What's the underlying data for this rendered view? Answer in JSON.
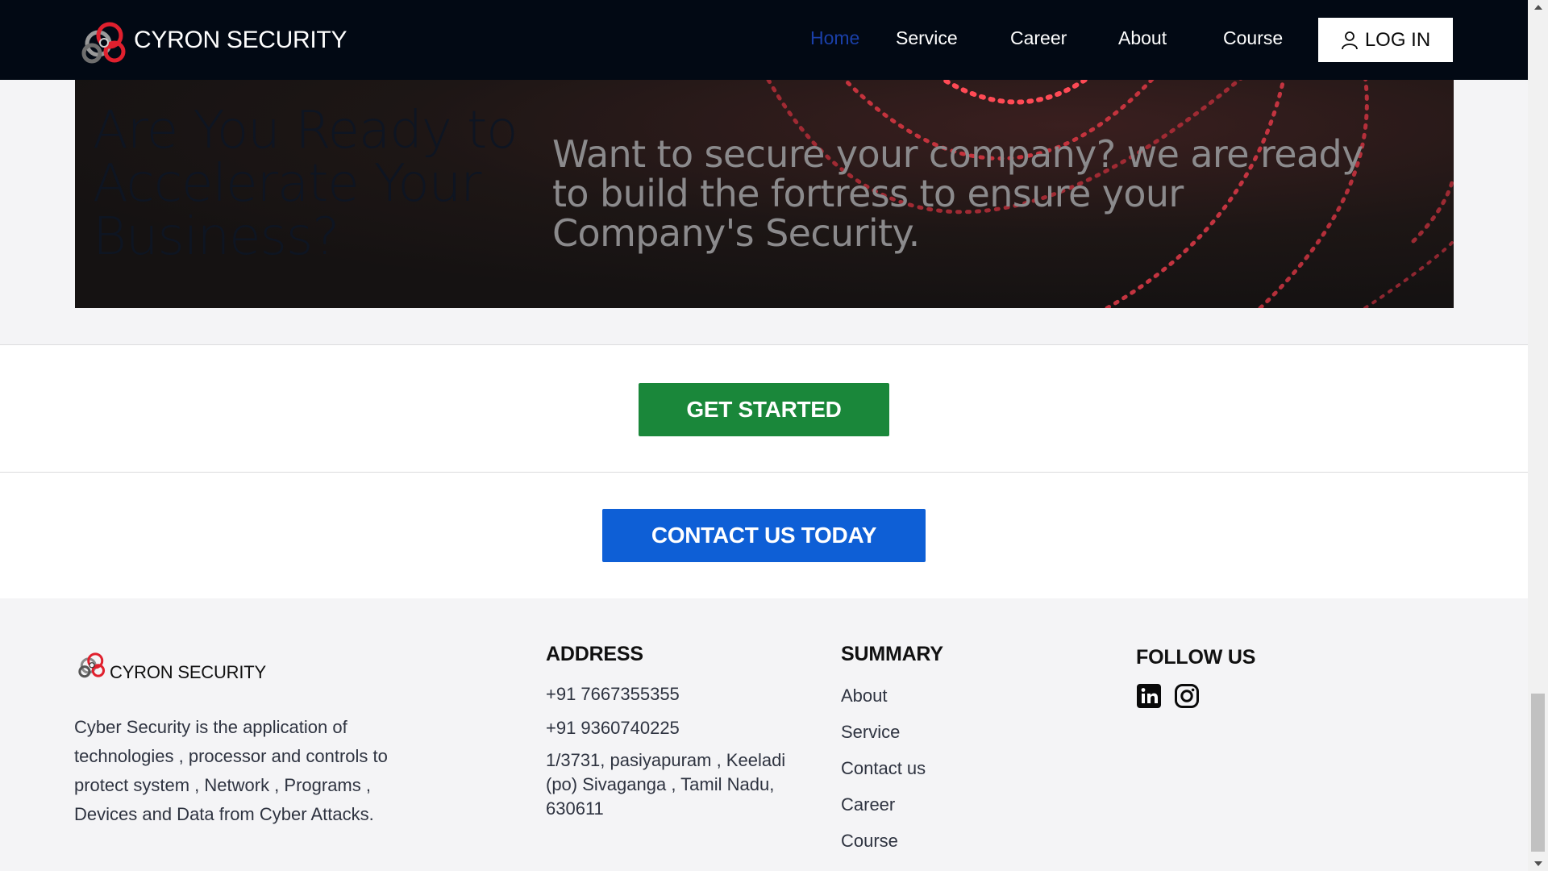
{
  "nav": {
    "brand": "CYRON SECURITY",
    "items": [
      "Home",
      "Service",
      "Career",
      "About",
      "Course"
    ],
    "active_item": "Home",
    "login_label": "LOG IN"
  },
  "hero": {
    "title": "Are You Ready to Accelerate Your Business?",
    "subtitle": "Want to secure your company? we are ready to build the fortress to ensure your Company's Security."
  },
  "cta": {
    "get_started": "GET STARTED",
    "contact": "CONTACT US TODAY"
  },
  "footer": {
    "brand": "CYRON SECURITY",
    "description": "Cyber Security is the application of technologies , processor and controls to protect system , Network , Programs , Devices and Data from Cyber Attacks.",
    "address": {
      "heading": "ADDRESS",
      "phone1": "+91 7667355355",
      "phone2": "+91 9360740225",
      "location": "1/3731, pasiyapuram , Keeladi (po) Sivaganga , Tamil Nadu, 630611"
    },
    "summary": {
      "heading": "SUMMARY",
      "links": [
        "About",
        "Service",
        "Contact us",
        "Career",
        "Course"
      ]
    },
    "follow": {
      "heading": "FOLLOW US",
      "icons": [
        "linkedin-icon",
        "instagram-icon"
      ]
    }
  },
  "colors": {
    "nav_bg": "#020914",
    "active_nav": "#1a3fa8",
    "green_button": "#1a873a",
    "blue_button": "#0e5fd6",
    "logo_red": "#e0202e"
  }
}
